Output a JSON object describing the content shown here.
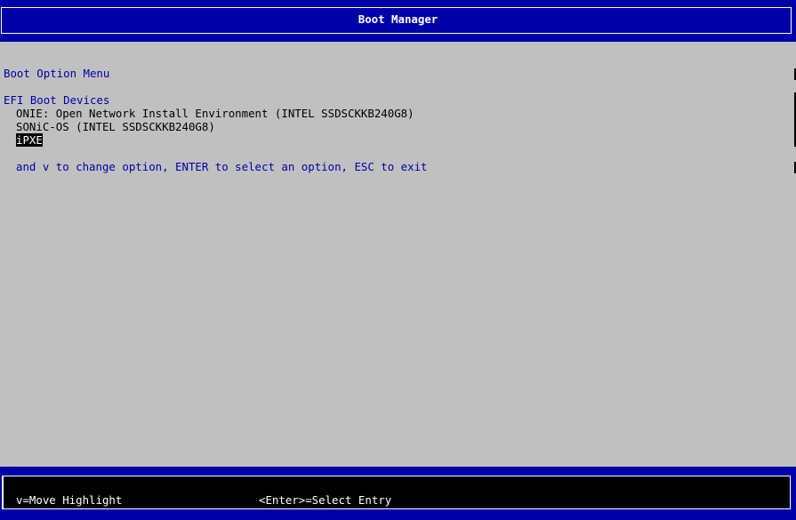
{
  "header": {
    "title": "Boot Manager"
  },
  "menu": {
    "heading": "Boot Option Menu",
    "section_label": "EFI Boot Devices",
    "options": [
      {
        "label": "ONIE: Open Network Install Environment (INTEL SSDSCKKB240G8)"
      },
      {
        "label": "SONiC-OS (INTEL SSDSCKKB240G8)"
      },
      {
        "label": "iPXE",
        "selected": true
      }
    ],
    "instructions": "and v to change option, ENTER to select an option, ESC to exit"
  },
  "footer": {
    "hint_move": "v=Move Highlight",
    "hint_select": "<Enter>=Select Entry"
  },
  "colors": {
    "background": "#c0c0c0",
    "band": "#0000a8",
    "text_blue": "#0000a8",
    "selection_bg": "#000000"
  }
}
